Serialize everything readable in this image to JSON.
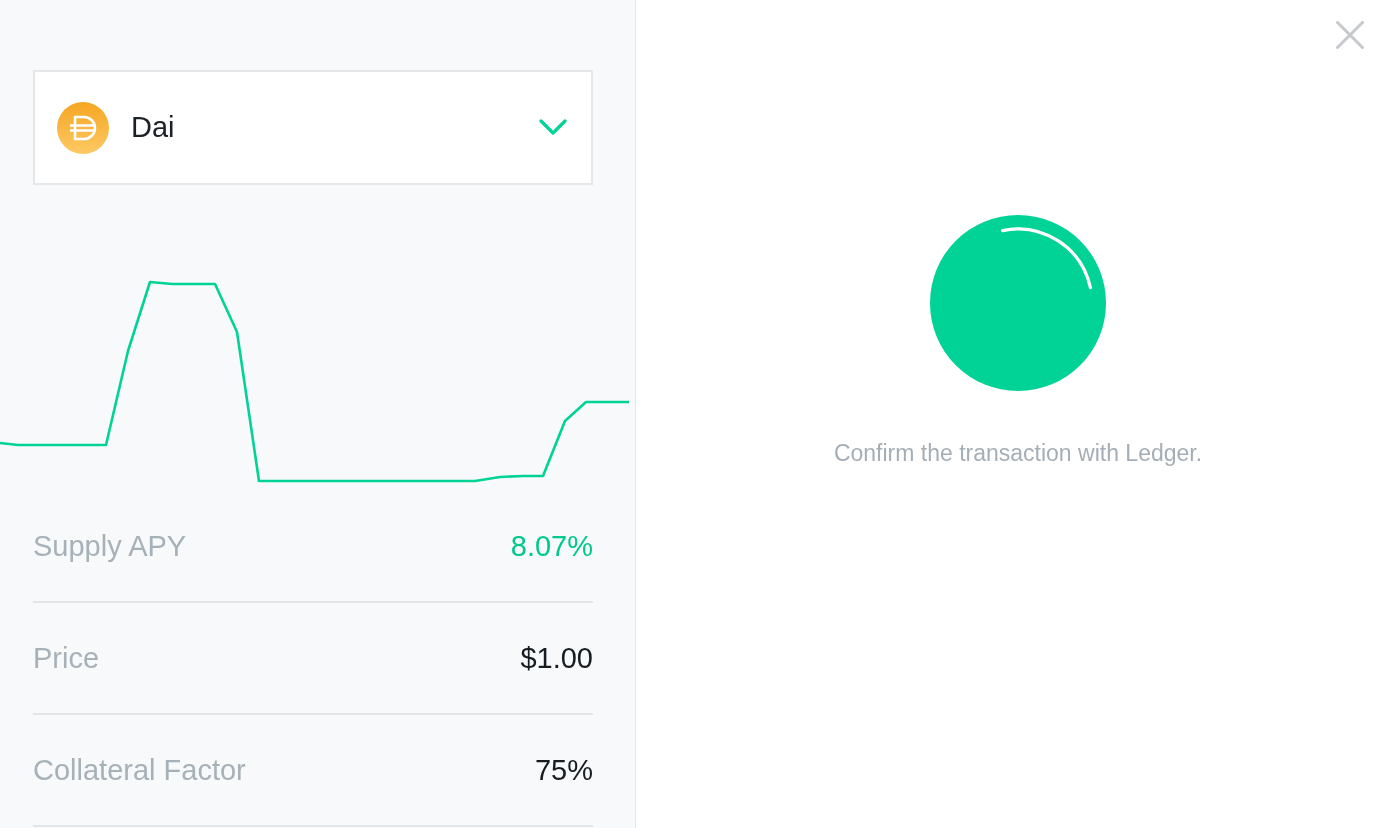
{
  "asset_selector": {
    "label": "Dai"
  },
  "stats": [
    {
      "label": "Supply APY",
      "value": "8.07%",
      "highlight": true
    },
    {
      "label": "Price",
      "value": "$1.00",
      "highlight": false
    },
    {
      "label": "Collateral Factor",
      "value": "75%",
      "highlight": false
    }
  ],
  "confirmation": {
    "message": "Confirm the transaction with Ledger."
  }
}
